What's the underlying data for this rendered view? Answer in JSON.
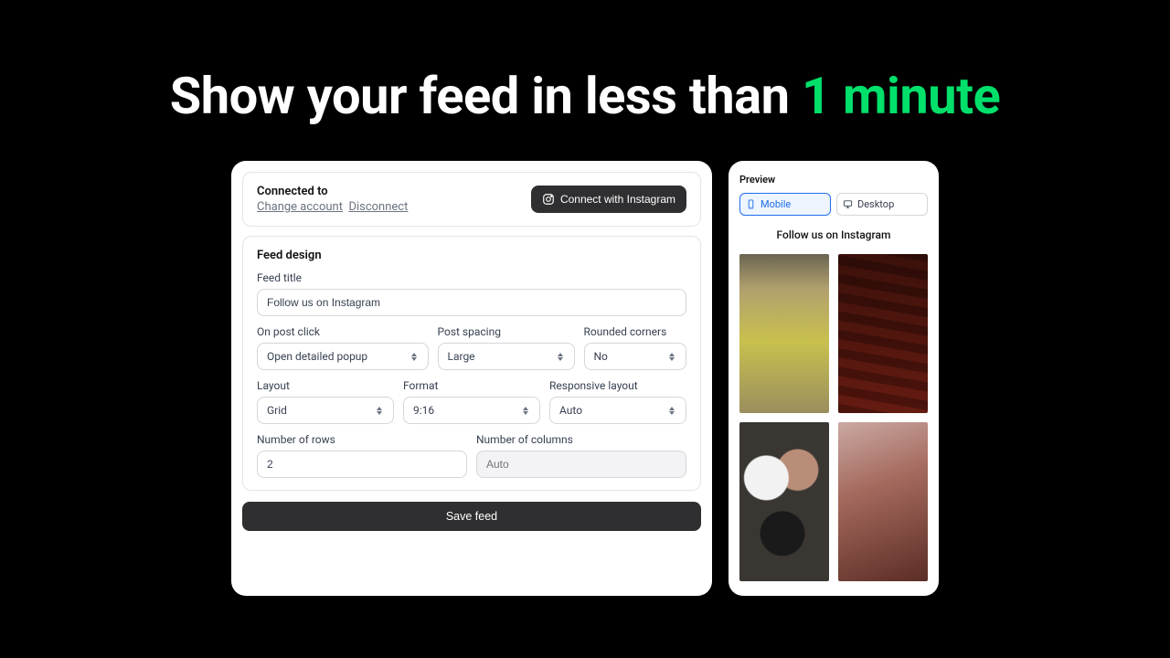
{
  "hero": {
    "prefix": "Show your feed in less than ",
    "accent": "1 minute"
  },
  "connect": {
    "title": "Connected to",
    "change": "Change account",
    "disconnect": "Disconnect",
    "button": "Connect with Instagram"
  },
  "design": {
    "heading": "Feed design",
    "feed_title_label": "Feed title",
    "feed_title_value": "Follow us on Instagram",
    "on_post_click": {
      "label": "On post click",
      "value": "Open detailed popup"
    },
    "post_spacing": {
      "label": "Post spacing",
      "value": "Large"
    },
    "rounded_corners": {
      "label": "Rounded corners",
      "value": "No"
    },
    "layout": {
      "label": "Layout",
      "value": "Grid"
    },
    "format": {
      "label": "Format",
      "value": "9:16"
    },
    "responsive": {
      "label": "Responsive layout",
      "value": "Auto"
    },
    "rows": {
      "label": "Number of rows",
      "value": "2"
    },
    "cols": {
      "label": "Number of columns",
      "placeholder": "Auto"
    }
  },
  "save_label": "Save feed",
  "preview": {
    "heading": "Preview",
    "mobile": "Mobile",
    "desktop": "Desktop",
    "feed_title": "Follow us on Instagram"
  }
}
